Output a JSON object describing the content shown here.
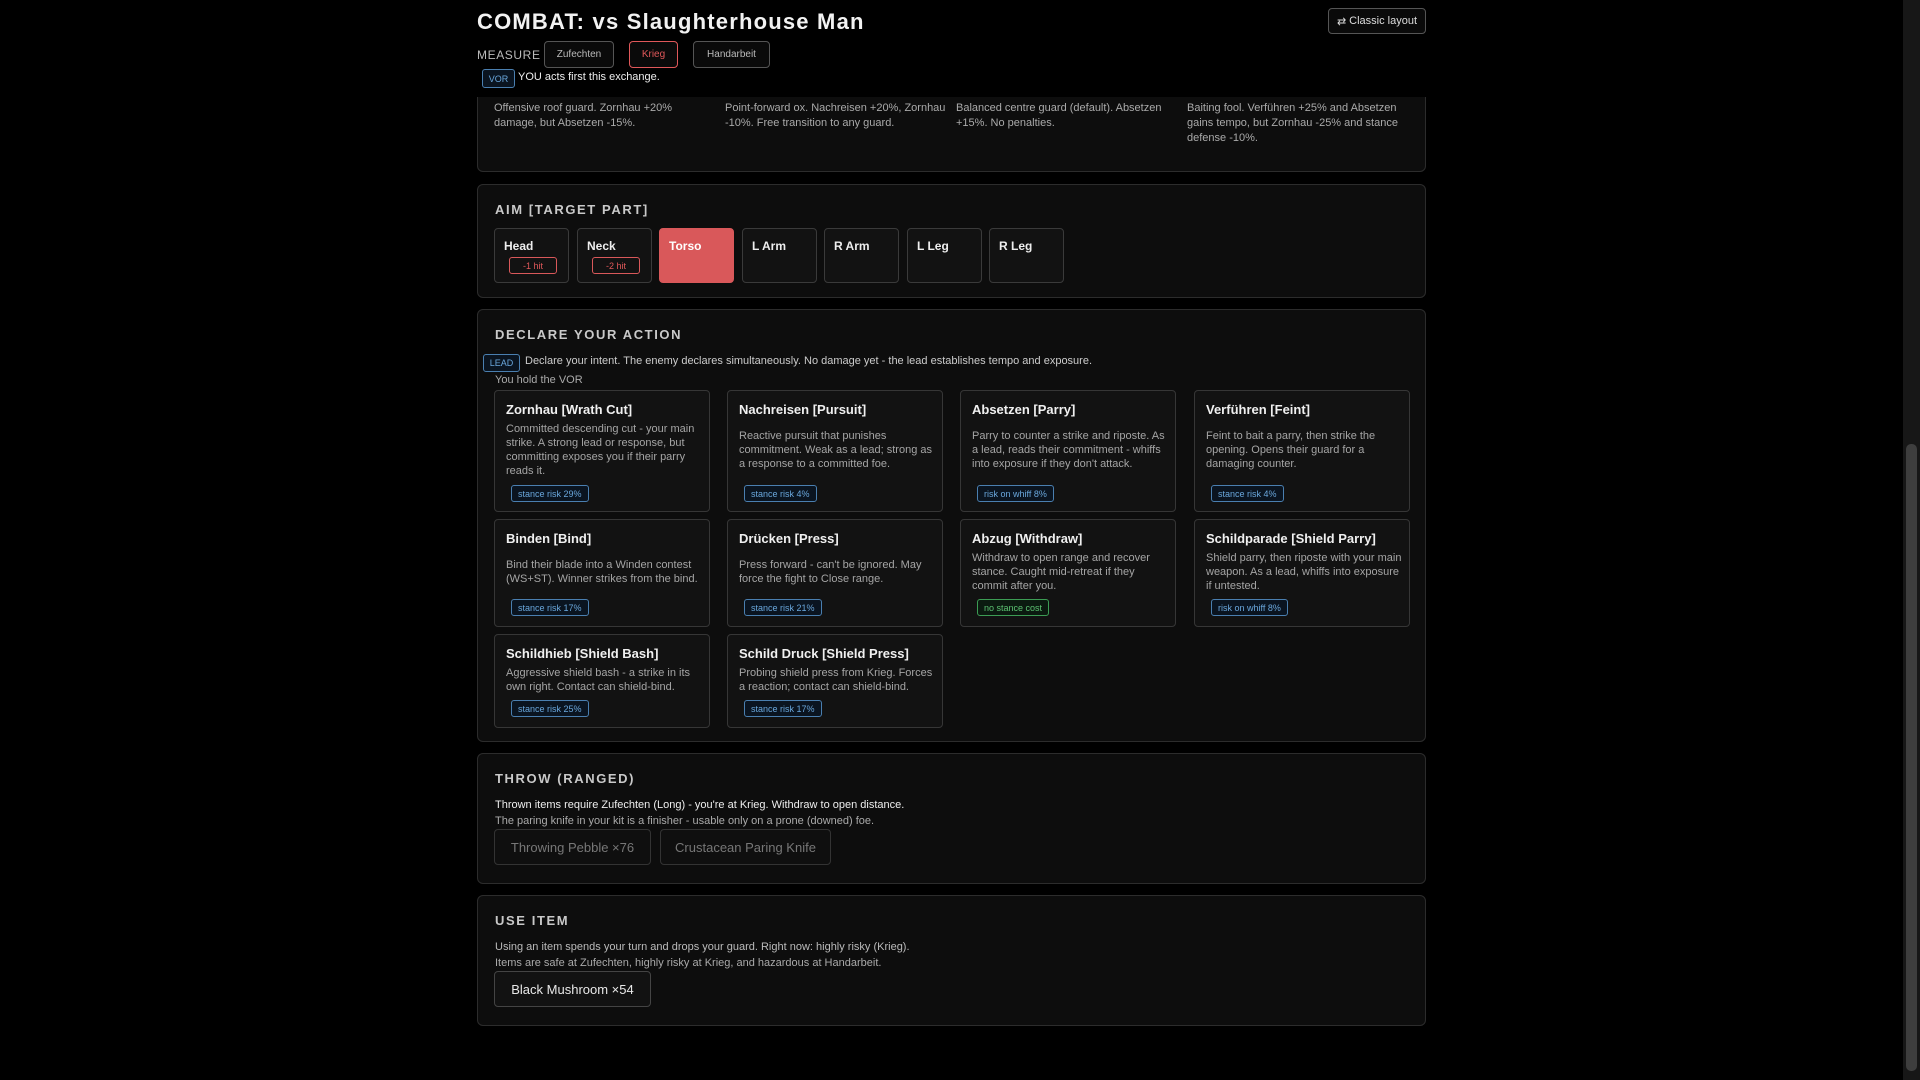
{
  "header": {
    "title": "COMBAT: vs Slaughterhouse Man",
    "layout_icon": "⇄",
    "layout_label": "Classic layout",
    "measure_label": "MEASURE",
    "measures": [
      {
        "label": "Zufechten",
        "active": false
      },
      {
        "label": "Krieg",
        "active": true
      },
      {
        "label": "Handarbeit",
        "active": false
      }
    ],
    "vor_tag": "VOR",
    "vor_text": "YOU acts first this exchange."
  },
  "stances": {
    "cards": [
      {
        "desc": "Offensive roof guard. Zornhau +20% damage, but Absetzen -15%.",
        "active": false
      },
      {
        "desc": "Point-forward ox. Nachreisen +20%, Zornhau -10%. Free transition to any guard.",
        "active": false
      },
      {
        "desc": "Balanced centre guard (default). Absetzen +15%. No penalties.",
        "active": true
      },
      {
        "desc": "Baiting fool. Verführen +25% and Absetzen gains tempo, but Zornhau -25% and stance defense -10%.",
        "active": false
      }
    ]
  },
  "aim": {
    "title": "AIM [TARGET PART]",
    "parts": [
      {
        "name": "Head",
        "mod": "-1 hit",
        "active": false
      },
      {
        "name": "Neck",
        "mod": "-2 hit",
        "active": false
      },
      {
        "name": "Torso",
        "mod": "",
        "active": true
      },
      {
        "name": "L Arm",
        "mod": "",
        "active": false
      },
      {
        "name": "R Arm",
        "mod": "",
        "active": false
      },
      {
        "name": "L Leg",
        "mod": "",
        "active": false
      },
      {
        "name": "R Leg",
        "mod": "",
        "active": false
      }
    ]
  },
  "declare": {
    "title": "DECLARE YOUR ACTION",
    "lead_tag": "LEAD",
    "lead_text": "Declare your intent. The enemy declares simultaneously. No damage yet - the lead establishes tempo and exposure.",
    "vor_hold": "You hold the VOR",
    "actions": [
      {
        "name": "Zornhau [Wrath Cut]",
        "desc": "Committed descending cut - your main strike. A strong lead or response, but committing exposes you if their parry reads it.",
        "badge": "stance risk 29%",
        "badge_kind": "blue"
      },
      {
        "name": "Nachreisen [Pursuit]",
        "desc": "Reactive pursuit that punishes commitment. Weak as a lead; strong as a response to a committed foe.",
        "badge": "stance risk 4%",
        "badge_kind": "blue"
      },
      {
        "name": "Absetzen [Parry]",
        "desc": "Parry to counter a strike and riposte. As a lead, reads their commitment - whiffs into exposure if they don't attack.",
        "badge": "risk on whiff 8%",
        "badge_kind": "blue"
      },
      {
        "name": "Verführen [Feint]",
        "desc": "Feint to bait a parry, then strike the opening. Opens their guard for a damaging counter.",
        "badge": "stance risk 4%",
        "badge_kind": "blue"
      },
      {
        "name": "Binden [Bind]",
        "desc": "Bind their blade into a Winden contest (WS+ST). Winner strikes from the bind.",
        "badge": "stance risk 17%",
        "badge_kind": "blue"
      },
      {
        "name": "Drücken [Press]",
        "desc": "Press forward - can't be ignored. May force the fight to Close range.",
        "badge": "stance risk 21%",
        "badge_kind": "blue"
      },
      {
        "name": "Abzug [Withdraw]",
        "desc": "Withdraw to open range and recover stance. Caught mid-retreat if they commit after you.",
        "badge": "no stance cost",
        "badge_kind": "green"
      },
      {
        "name": "Schildparade [Shield Parry]",
        "desc": "Shield parry, then riposte with your main weapon. As a lead, whiffs into exposure if untested.",
        "badge": "risk on whiff 8%",
        "badge_kind": "blue"
      },
      {
        "name": "Schildhieb [Shield Bash]",
        "desc": "Aggressive shield bash - a strike in its own right. Contact can shield-bind.",
        "badge": "stance risk 25%",
        "badge_kind": "blue"
      },
      {
        "name": "Schild Druck [Shield Press]",
        "desc": "Probing shield press from Krieg. Forces a reaction; contact can shield-bind.",
        "badge": "stance risk 17%",
        "badge_kind": "blue"
      }
    ]
  },
  "throw": {
    "title": "THROW (RANGED)",
    "note": "Thrown items require Zufechten (Long) - you're at Krieg. Withdraw to open distance.",
    "sub": "The paring knife in your kit is a finisher - usable only on a prone (downed) foe.",
    "items": [
      "Throwing Pebble ×76",
      "Crustacean Paring Knife"
    ]
  },
  "use_item": {
    "title": "USE ITEM",
    "note": "Using an item spends your turn and drops your guard. Right now: highly risky (Krieg).",
    "sub": "Items are safe at Zufechten, highly risky at Krieg, and hazardous at Handarbeit.",
    "items": [
      "Black Mushroom ×54"
    ]
  },
  "colors": {
    "accent_red": "#d9585a",
    "badge_blue": "#6aa7dc",
    "badge_green": "#5cc272"
  }
}
